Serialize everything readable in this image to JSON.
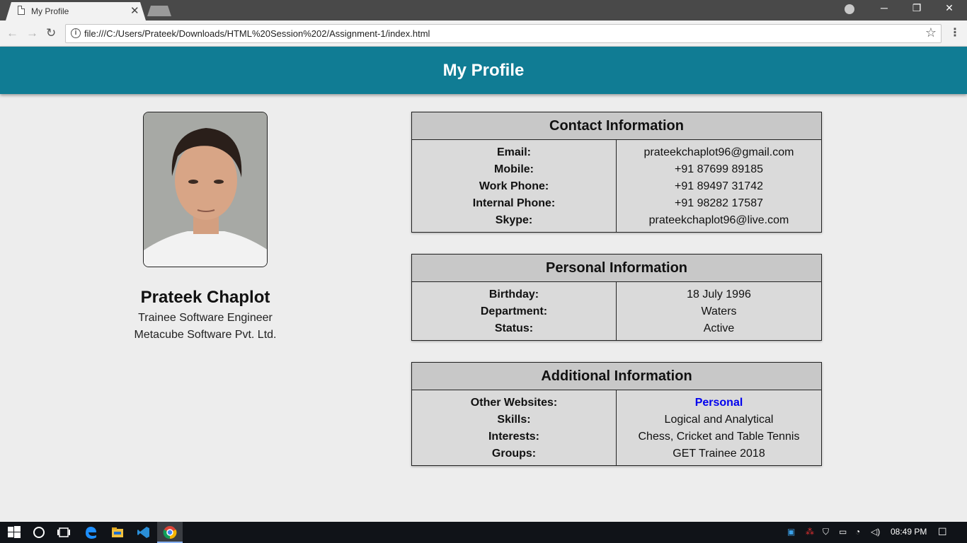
{
  "browser": {
    "tab_title": "My Profile",
    "url": "file:///C:/Users/Prateek/Downloads/HTML%20Session%202/Assignment-1/index.html"
  },
  "header": {
    "title": "My Profile"
  },
  "profile": {
    "name": "Prateek Chaplot",
    "role": "Trainee Software Engineer",
    "company": "Metacube Software Pvt. Ltd."
  },
  "contact": {
    "title": "Contact Information",
    "labels": [
      "Email:",
      "Mobile:",
      "Work Phone:",
      "Internal Phone:",
      "Skype:"
    ],
    "values": [
      "prateekchaplot96@gmail.com",
      "+91 87699 89185",
      "+91 89497 31742",
      "+91 98282 17587",
      "prateekchaplot96@live.com"
    ]
  },
  "personal": {
    "title": "Personal Information",
    "labels": [
      "Birthday:",
      "Department:",
      "Status:"
    ],
    "values": [
      "18 July 1996",
      "Waters",
      "Active"
    ]
  },
  "additional": {
    "title": "Additional Information",
    "labels": [
      "Other Websites:",
      "Skills:",
      "Interests:",
      "Groups:"
    ],
    "values": [
      "Personal",
      "Logical and Analytical",
      "Chess, Cricket and Table Tennis",
      "GET Trainee 2018"
    ]
  },
  "taskbar": {
    "time": "08:49 PM"
  },
  "colors": {
    "header": "#107c94",
    "link": "#0000ee"
  }
}
